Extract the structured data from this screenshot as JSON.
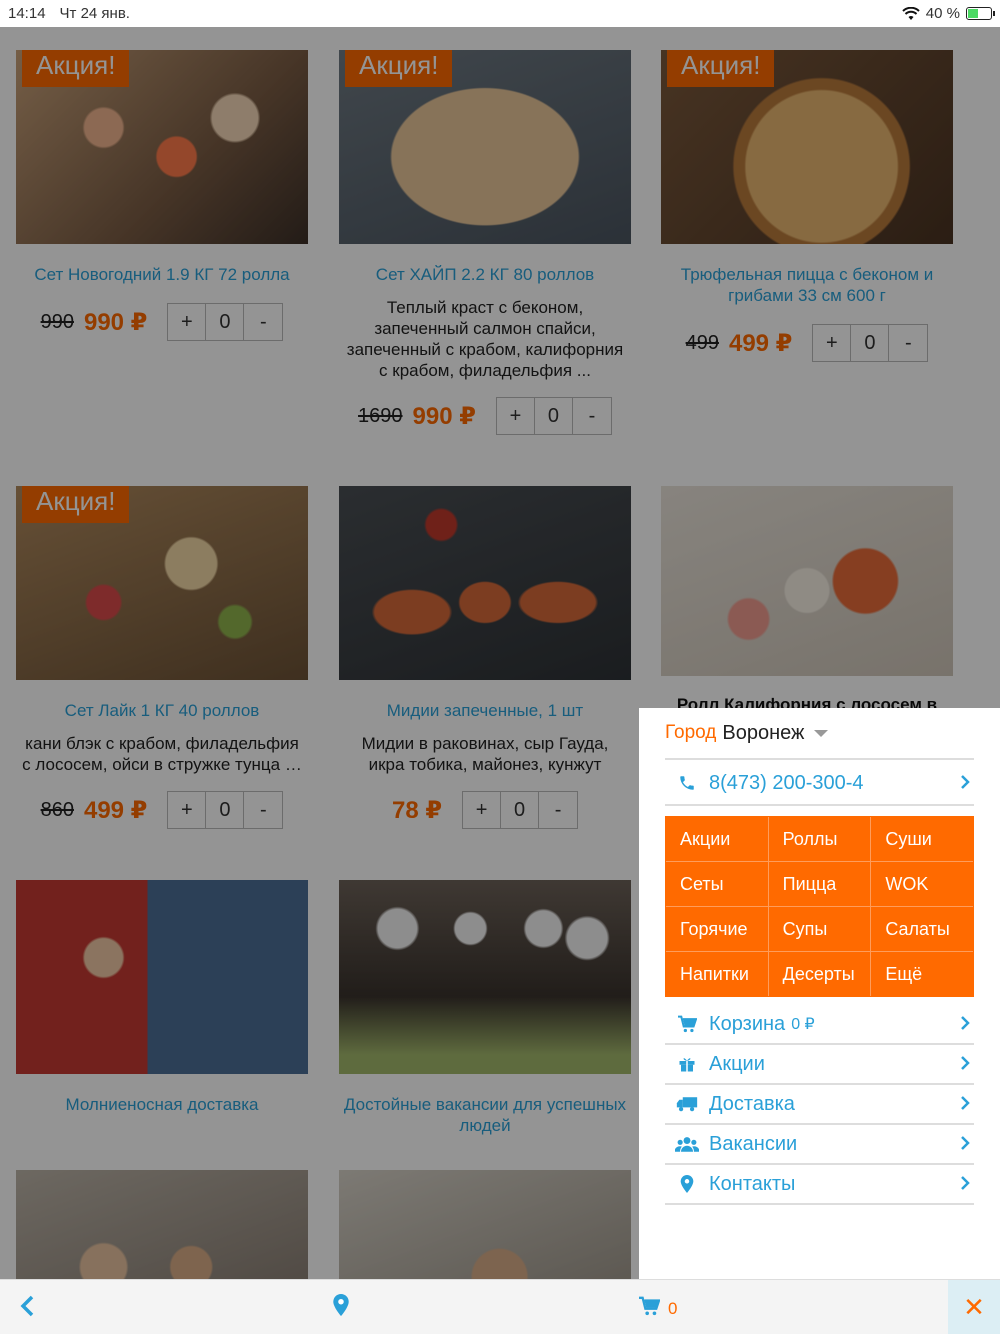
{
  "status": {
    "time": "14:14",
    "date": "Чт 24 янв.",
    "battery": "40 %",
    "battery_level": 0.4
  },
  "products": [
    {
      "badge": "Акция!",
      "title": "Сет Новогодний 1.9 КГ 72 ролла",
      "desc": "",
      "old_price": "990",
      "price": "990 ₽",
      "plus": "+",
      "qty": "0",
      "minus": "-"
    },
    {
      "badge": "Акция!",
      "title": "Сет ХАЙП 2.2 КГ 80 роллов",
      "desc": "Теплый краст с беконом, запеченный салмон спайси, запеченный с крабом, калифорния с крабом, филадельфия ...",
      "old_price": "1690",
      "price": "990 ₽",
      "plus": "+",
      "qty": "0",
      "minus": "-"
    },
    {
      "badge": "Акция!",
      "title": "Трюфельная пицца с беконом и грибами 33 см 600 г",
      "desc": "",
      "old_price": "499",
      "price": "499 ₽",
      "plus": "+",
      "qty": "0",
      "minus": "-"
    },
    {
      "badge": "Акция!",
      "title": "Сет Лайк 1 КГ 40 роллов",
      "desc": "кани блэк с крабом, филадельфия с лососем, ойси в стружке тунца …",
      "old_price": "860",
      "price": "499 ₽",
      "plus": "+",
      "qty": "0",
      "minus": "-"
    },
    {
      "badge": "",
      "title": "Мидии запеченные, 1 шт",
      "desc": "Мидии в раковинах, сыр Гауда, икра тобика, майонез, кунжут",
      "old_price": "",
      "price": "78 ₽",
      "plus": "+",
      "qty": "0",
      "minus": "-"
    },
    {
      "badge": "",
      "title": "Ролл Калифорния с лососем в",
      "desc": "",
      "old_price": "",
      "price": "",
      "plus": "",
      "qty": "",
      "minus": ""
    }
  ],
  "info_cards": [
    {
      "title": "Молниеносная доставка"
    },
    {
      "title": "Достойные вакансии для успешных людей"
    }
  ],
  "menu": {
    "city_label": "Город",
    "city_value": "Воронеж",
    "phone": "8(473) 200-300-4",
    "categories": [
      "Акции",
      "Роллы",
      "Суши",
      "Сеты",
      "Пицца",
      "WOK",
      "Горячие",
      "Супы",
      "Салаты",
      "Напитки",
      "Десерты",
      "Ещё"
    ],
    "links": [
      {
        "label": "Корзина",
        "extra": "0 ₽",
        "icon": "cart-icon"
      },
      {
        "label": "Акции",
        "extra": "",
        "icon": "gift-icon"
      },
      {
        "label": "Доставка",
        "extra": "",
        "icon": "truck-icon"
      },
      {
        "label": "Вакансии",
        "extra": "",
        "icon": "users-icon"
      },
      {
        "label": "Контакты",
        "extra": "",
        "icon": "map-pin-icon"
      }
    ]
  },
  "bottom": {
    "cart_count": "0",
    "close": "✕"
  },
  "colors": {
    "accent": "#ff6a00",
    "link": "#2aa0d8"
  }
}
